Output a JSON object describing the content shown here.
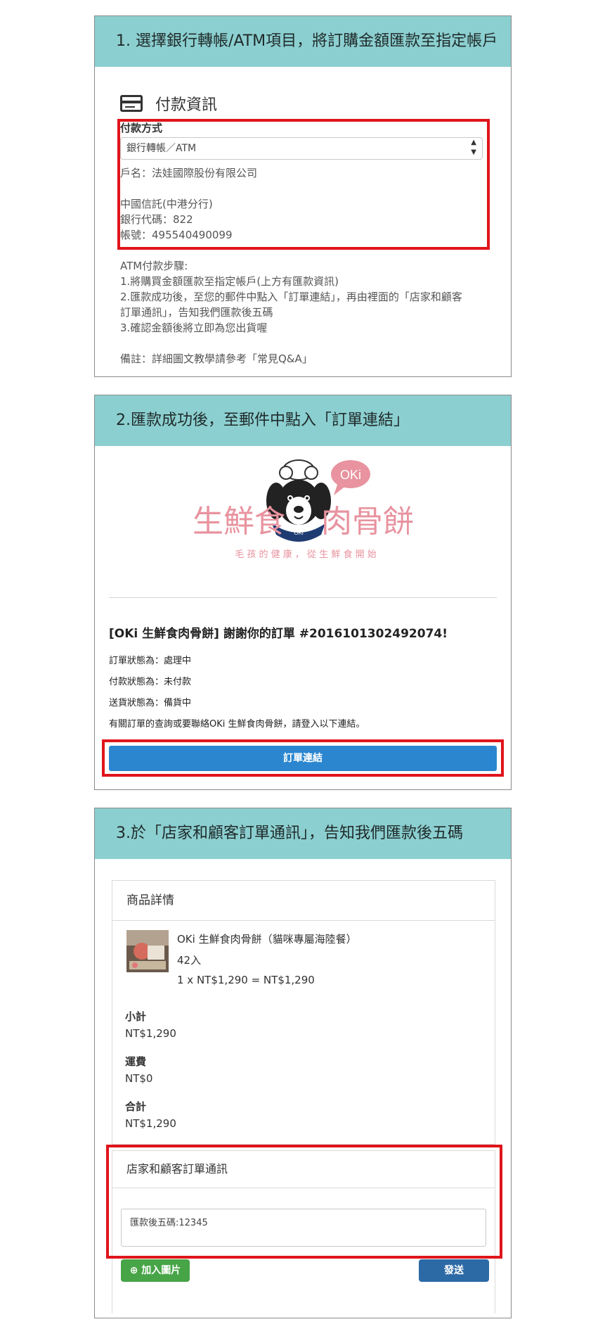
{
  "step1": {
    "title": "1. 選擇銀行轉帳/ATM項目，將訂購金額匯款至指定帳戶",
    "section_title": "付款資訊",
    "payment_method_label": "付款方式",
    "payment_method_value": "銀行轉帳／ATM",
    "account_name": "戶名：法娃國際股份有限公司",
    "bank_name": "中國信託(中港分行)",
    "bank_code": "銀行代碼：822",
    "account_number": "帳號：495540490099",
    "steps_title": "ATM付款步驟:",
    "step_line_1": "1.將購買金額匯款至指定帳戶(上方有匯款資訊)",
    "step_line_2a": "2.匯款成功後，至您的郵件中點入「訂單連結」，再由裡面的「店家和顧客",
    "step_line_2b": "訂單通訊」，告知我們匯款後五碼",
    "step_line_3": "3.確認金額後將立即為您出貨喔",
    "note": "備註：詳細圖文教學請參考「常見Q&A」"
  },
  "step2": {
    "title": "2.匯款成功後，至郵件中點入「訂單連結」",
    "logo": {
      "left_text": "生鮮食",
      "right_text": "肉骨餅",
      "bubble": "OKi",
      "badge": "OKi",
      "slogan": "毛 孩 的 健 康 ， 從 生 鮮 食 開 始"
    },
    "email_heading": "[OKi 生鮮食肉骨餅] 謝謝你的訂單 #2016101302492074!",
    "order_status": "訂單狀態為：處理中",
    "payment_status": "付款狀態為：未付款",
    "shipping_status": "送貨狀態為：備貨中",
    "contact_note": "有關訂單的查詢或要聯絡OKi 生鮮食肉骨餅，請登入以下連結。",
    "order_link_button": "訂單連結"
  },
  "step3": {
    "title": "3.於「店家和顧客訂單通訊」，告知我們匯款後五碼",
    "product_card_title": "商品詳情",
    "product_name": "OKi 生鮮食肉骨餅（貓咪專屬海陸餐）",
    "product_qty": "42入",
    "product_price": "1 x NT$1,290 = NT$1,290",
    "subtotal_label": "小計",
    "subtotal_value": "NT$1,290",
    "shipping_label": "運費",
    "shipping_value": "NT$0",
    "total_label": "合計",
    "total_value": "NT$1,290",
    "message_card_title": "店家和顧客訂單通訊",
    "message_text": "匯款後五碼:12345",
    "add_image_button": "加入圖片",
    "send_button": "發送"
  },
  "colors": {
    "panel_header": "#8ccfd0",
    "highlight_red": "#e0141b",
    "link_blue": "#2b86cf",
    "send_blue": "#2c6aa6",
    "add_green": "#47a447",
    "logo_pink": "#e8939f"
  }
}
